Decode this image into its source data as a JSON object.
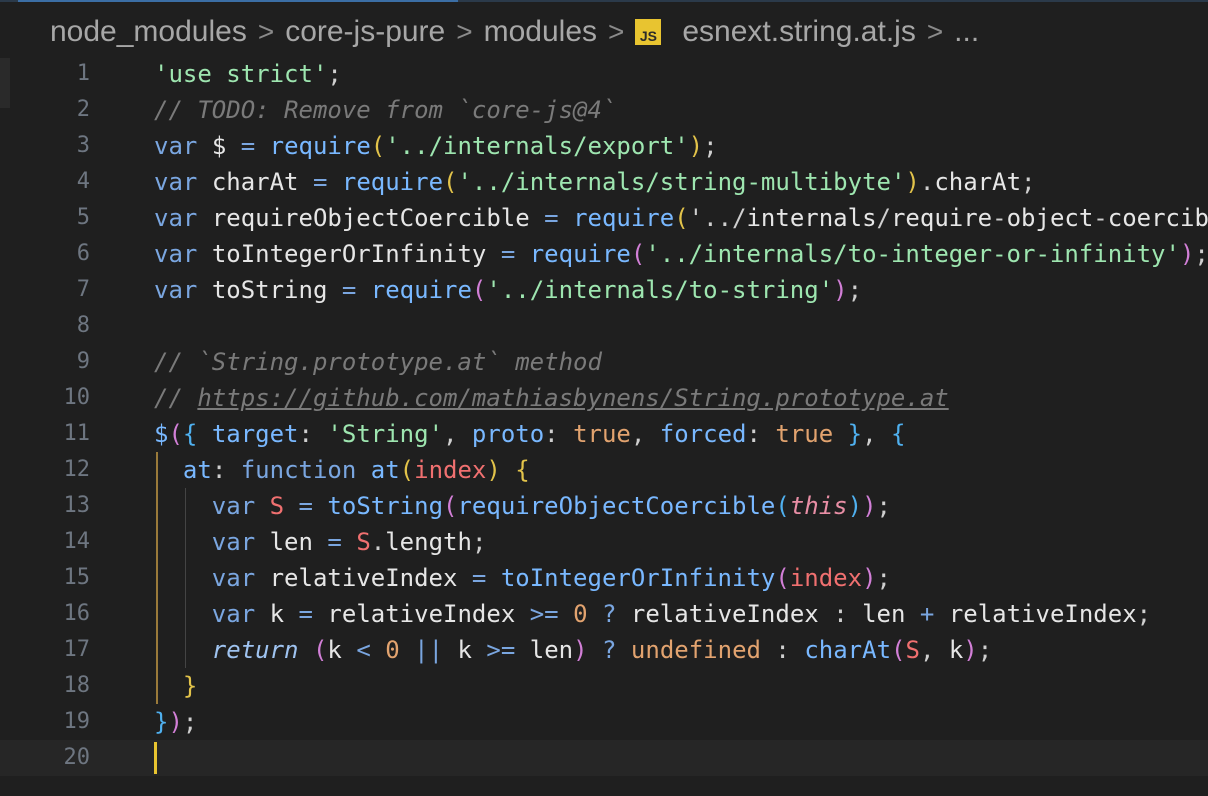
{
  "breadcrumb": {
    "items": [
      "node_modules",
      "core-js-pure",
      "modules"
    ],
    "file_icon_text": "JS",
    "file": "esnext.string.at.js",
    "separator": ">",
    "more": "..."
  },
  "editor": {
    "language": "javascript",
    "active_line": 20,
    "lines": [
      {
        "n": "1",
        "text": "'use strict';"
      },
      {
        "n": "2",
        "text": "// TODO: Remove from `core-js@4`"
      },
      {
        "n": "3",
        "text": "var $ = require('../internals/export');"
      },
      {
        "n": "4",
        "text": "var charAt = require('../internals/string-multibyte').charAt;"
      },
      {
        "n": "5",
        "text": "var requireObjectCoercible = require('../internals/require-object-coercib"
      },
      {
        "n": "6",
        "text": "var toIntegerOrInfinity = require('../internals/to-integer-or-infinity');"
      },
      {
        "n": "7",
        "text": "var toString = require('../internals/to-string');"
      },
      {
        "n": "8",
        "text": ""
      },
      {
        "n": "9",
        "text": "// `String.prototype.at` method"
      },
      {
        "n": "10",
        "text": "// https://github.com/mathiasbynens/String.prototype.at"
      },
      {
        "n": "11",
        "text": "$({ target: 'String', proto: true, forced: true }, {"
      },
      {
        "n": "12",
        "text": "  at: function at(index) {"
      },
      {
        "n": "13",
        "text": "    var S = toString(requireObjectCoercible(this));"
      },
      {
        "n": "14",
        "text": "    var len = S.length;"
      },
      {
        "n": "15",
        "text": "    var relativeIndex = toIntegerOrInfinity(index);"
      },
      {
        "n": "16",
        "text": "    var k = relativeIndex >= 0 ? relativeIndex : len + relativeIndex;"
      },
      {
        "n": "17",
        "text": "    return (k < 0 || k >= len) ? undefined : charAt(S, k);"
      },
      {
        "n": "18",
        "text": "  }"
      },
      {
        "n": "19",
        "text": "});"
      },
      {
        "n": "20",
        "text": ""
      }
    ]
  },
  "colors": {
    "background": "#1f1f1f",
    "keyword": "#7aa6e0",
    "string": "#9ee6b0",
    "comment": "#7a7a7a",
    "cursor": "#e8c430"
  }
}
